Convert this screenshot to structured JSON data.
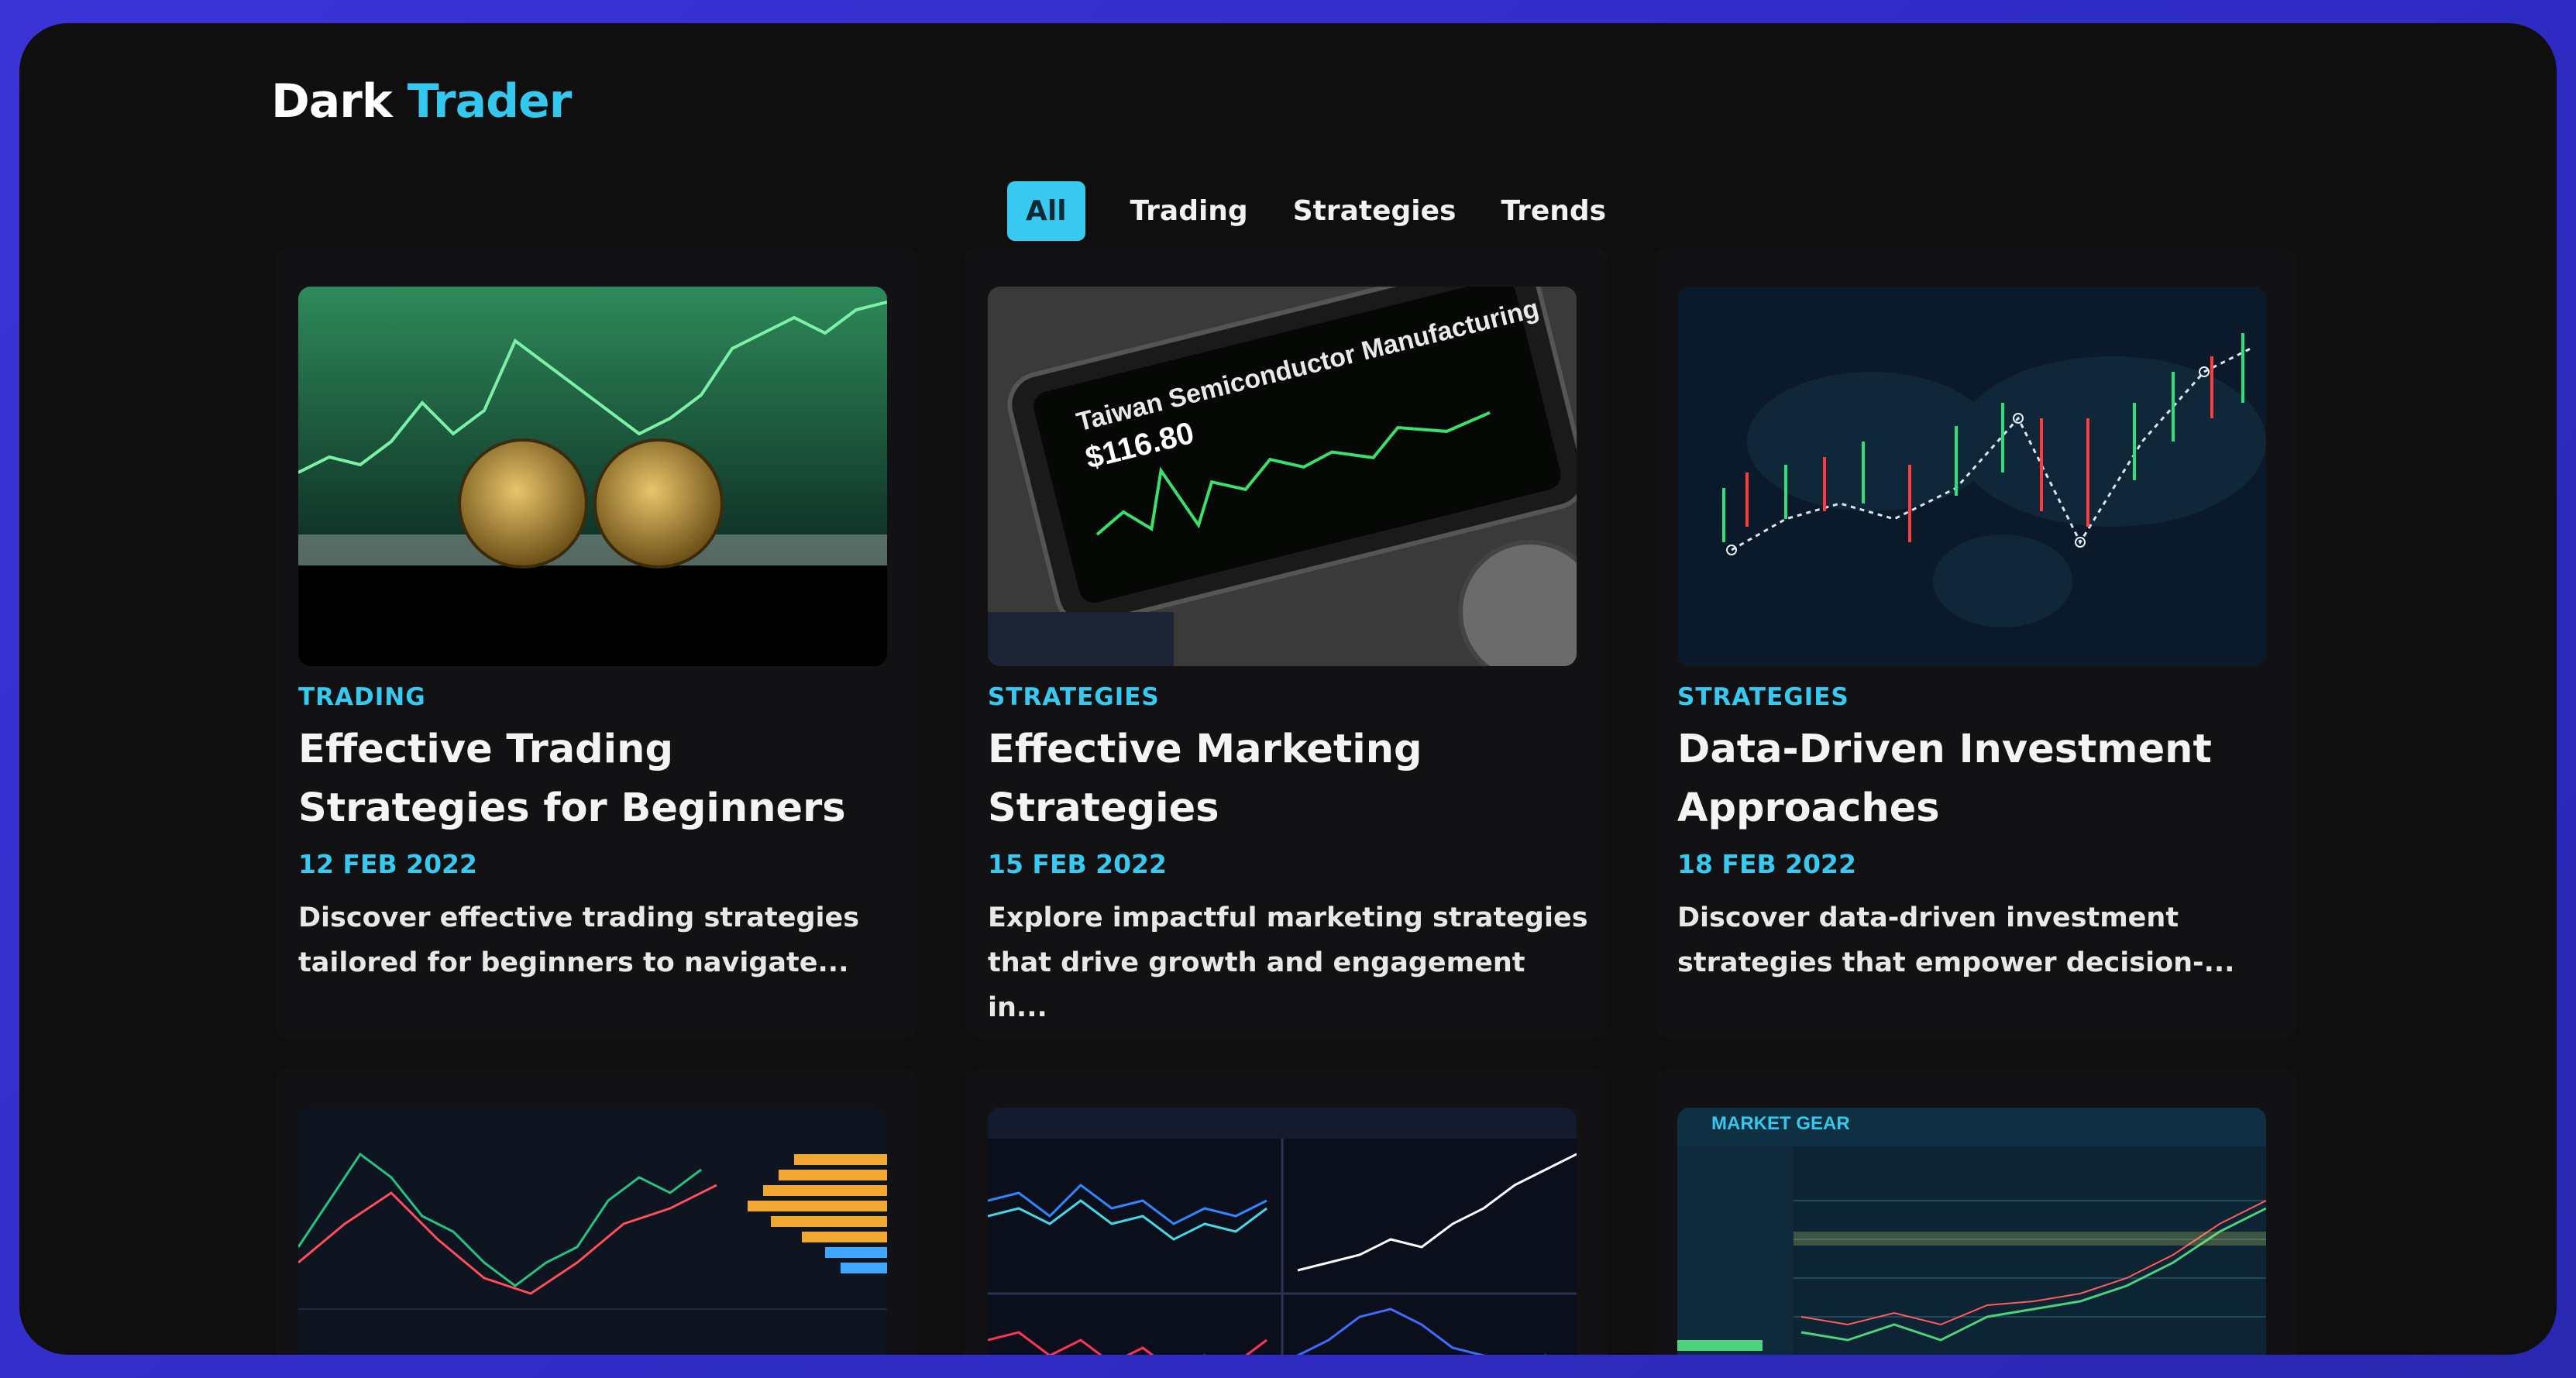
{
  "brand": {
    "name_part1": "Dark",
    "name_part2": "Trader"
  },
  "filters": [
    {
      "label": "All",
      "active": true
    },
    {
      "label": "Trading",
      "active": false
    },
    {
      "label": "Strategies",
      "active": false
    },
    {
      "label": "Trends",
      "active": false
    }
  ],
  "posts": [
    {
      "category": "TRADING",
      "title": "Effective Trading Strategies for Beginners",
      "date": "12 FEB 2022",
      "excerpt": "Discover effective trading strategies tailored for beginners to navigate..."
    },
    {
      "category": "STRATEGIES",
      "title": "Effective Marketing Strategies",
      "date": "15 FEB 2022",
      "excerpt": "Explore impactful marketing strategies that drive growth and engagement in..."
    },
    {
      "category": "STRATEGIES",
      "title": "Data-Driven Investment Approaches",
      "date": "18 FEB 2022",
      "excerpt": "Discover data-driven investment strategies that empower decision-..."
    }
  ],
  "thumbnail_texts": {
    "phone_company": "Taiwan Semiconductor Manufacturing",
    "phone_price": "$116.80",
    "market_gear_brand": "MARKET GEAR"
  },
  "colors": {
    "accent": "#37c9f0",
    "background": "#0f0f10",
    "page_gradient": "#3b33d6"
  }
}
